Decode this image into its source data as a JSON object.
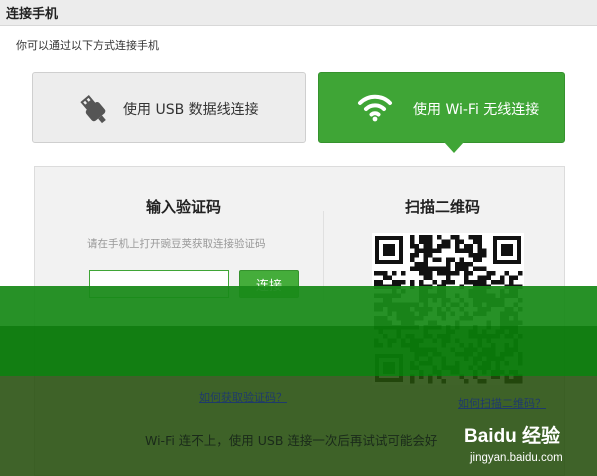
{
  "window": {
    "title": "连接手机"
  },
  "subtitle": "你可以通过以下方式连接手机",
  "options": {
    "usb": {
      "label": "使用 USB 数据线连接",
      "icon": "usb-icon"
    },
    "wifi": {
      "label": "使用 Wi-Fi 无线连接",
      "icon": "wifi-icon",
      "selected": true
    }
  },
  "code_section": {
    "title": "输入验证码",
    "hint": "请在手机上打开豌豆荚获取连接验证码",
    "input_value": "",
    "button_label": "连接",
    "help_link": "如何获取验证码？"
  },
  "qr_section": {
    "title": "扫描二维码",
    "help_link": "如何扫描二维码？"
  },
  "footer_text": "Wi-Fi 连不上，使用 USB 连接一次后再试试可能会好",
  "watermark": {
    "brand": "Baidu 经验",
    "url": "jingyan.baidu.com"
  },
  "colors": {
    "accent": "#3fa536",
    "link": "#1f3a6b",
    "panel": "#f2f2f2"
  }
}
